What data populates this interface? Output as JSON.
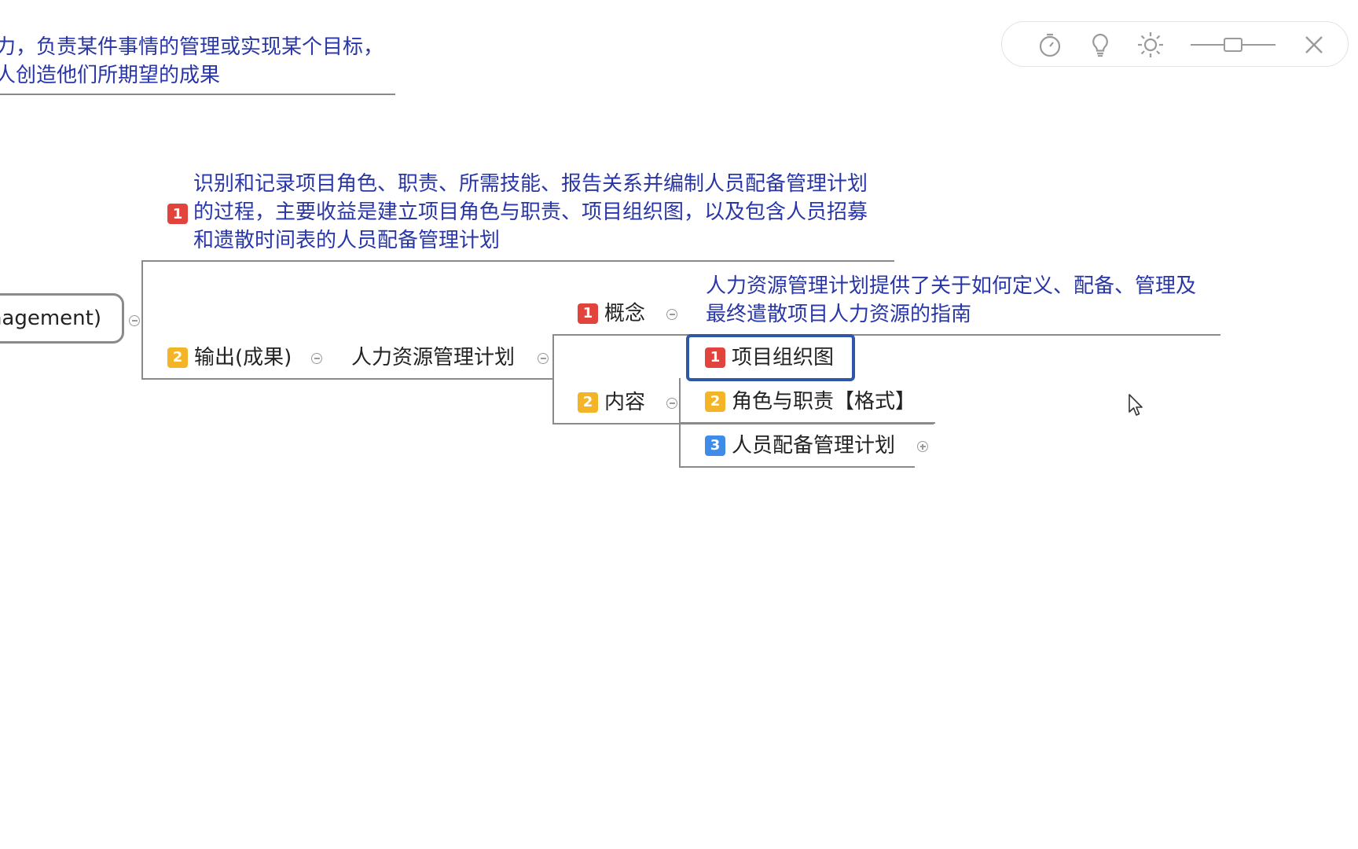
{
  "top_note": {
    "line1": "力，负责某件事情的管理或实现某个目标，",
    "line2": "人创造他们所期望的成果"
  },
  "root_node": {
    "label": "nagement)"
  },
  "definition_note": {
    "badge": "1",
    "line1": "识别和记录项目角色、职责、所需技能、报告关系并编制人员配备管理计划",
    "line2": "的过程，主要收益是建立项目角色与职责、项目组织图，以及包含人员招募",
    "line3": "和遗散时间表的人员配备管理计划"
  },
  "output_node": {
    "badge": "2",
    "label": "输出(成果)"
  },
  "plan_node": {
    "label": "人力资源管理计划"
  },
  "concept_node": {
    "badge": "1",
    "label": "概念"
  },
  "concept_note": {
    "line1": "人力资源管理计划提供了关于如何定义、配备、管理及",
    "line2": "最终遣散项目人力资源的指南"
  },
  "content_node": {
    "badge": "2",
    "label": "内容"
  },
  "content_items": [
    {
      "badge": "1",
      "label": "项目组织图"
    },
    {
      "badge": "2",
      "label": "角色与职责【格式】"
    },
    {
      "badge": "3",
      "label": "人员配备管理计划"
    }
  ],
  "toolbar": {
    "icons": [
      "timer-icon",
      "lightbulb-icon",
      "brightness-icon",
      "zoom-slider",
      "close-icon"
    ],
    "zoom_level": 0.5
  },
  "colors": {
    "note_text": "#2936a6",
    "badge_red": "#e0443c",
    "badge_orange": "#f4b428",
    "badge_blue": "#3e8ce8",
    "selection": "#2f56a8"
  }
}
